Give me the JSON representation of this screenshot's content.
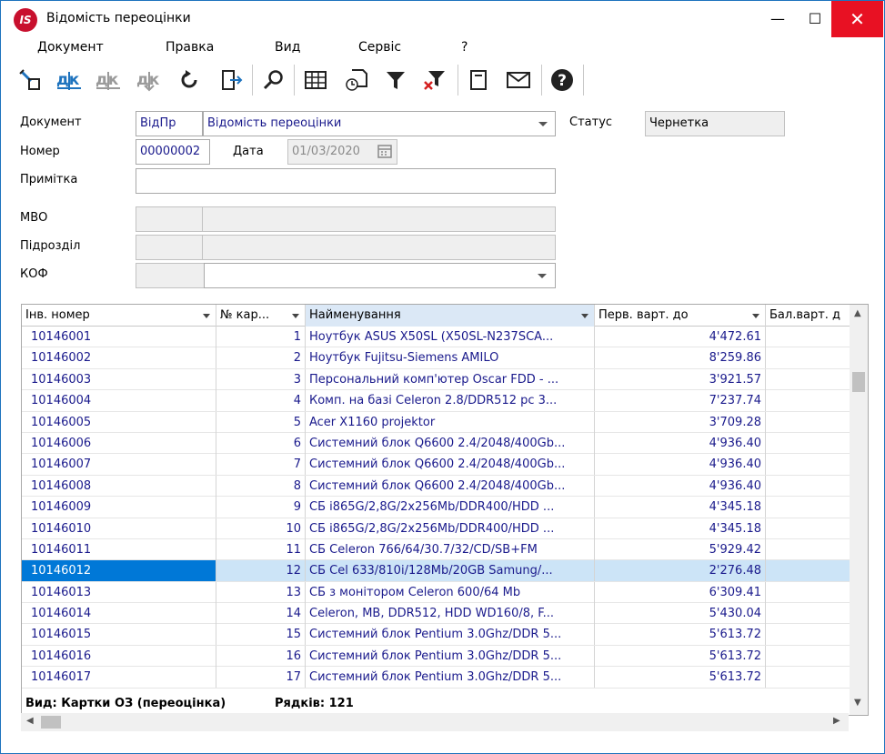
{
  "window": {
    "title": "Відомість переоцінки",
    "logo_text": "IS",
    "minimize_glyph": "—",
    "maximize_glyph": "☐",
    "close_glyph": "✕"
  },
  "menu": [
    "Документ",
    "Правка",
    "Вид",
    "Сервіс",
    "?"
  ],
  "toolbar": {
    "icons": [
      "new-document-icon",
      "dk-icon",
      "dk-disabled-icon",
      "dk-down-disabled-icon",
      "refresh-icon",
      "exit-icon",
      "search-icon",
      "table-view-icon",
      "history-icon",
      "filter-icon",
      "clear-filter-icon",
      "page-icon",
      "mail-icon",
      "help-icon"
    ]
  },
  "form": {
    "document_label": "Документ",
    "document_code": "ВідПр",
    "document_name": "Відомість переоцінки",
    "status_label": "Статус",
    "status_value": "Чернетка",
    "number_label": "Номер",
    "number_value": "00000002",
    "date_label": "Дата",
    "date_value": "01/03/2020",
    "note_label": "Примітка",
    "note_value": "",
    "mvo_label": "МВО",
    "mvo_code": "",
    "mvo_name": "",
    "dept_label": "Підрозділ",
    "dept_code": "",
    "dept_name": "",
    "kof_label": "КОФ",
    "kof_code": "",
    "kof_name": ""
  },
  "grid": {
    "columns": [
      "Інв. номер",
      "№ кар...",
      "Найменування",
      "Перв. варт. до",
      "Бал.варт. д"
    ],
    "selected_row_index": 11,
    "rows": [
      {
        "inv": "10146001",
        "card": "1",
        "name": "Ноутбук ASUS X50SL (X50SL-N237SCA...",
        "value": "4'472.61"
      },
      {
        "inv": "10146002",
        "card": "2",
        "name": "Ноутбук Fujitsu-Siemens AMILO",
        "value": "8'259.86"
      },
      {
        "inv": "10146003",
        "card": "3",
        "name": "Персональний комп'ютер Oscar FDD - ...",
        "value": "3'921.57"
      },
      {
        "inv": "10146004",
        "card": "4",
        "name": "Комп. на базі Celeron 2.8/DDR512 pc 3...",
        "value": "7'237.74"
      },
      {
        "inv": "10146005",
        "card": "5",
        "name": "Acer X1160 projektor",
        "value": "3'709.28"
      },
      {
        "inv": "10146006",
        "card": "6",
        "name": "Системний блок Q6600 2.4/2048/400Gb...",
        "value": "4'936.40"
      },
      {
        "inv": "10146007",
        "card": "7",
        "name": "Системний блок Q6600 2.4/2048/400Gb...",
        "value": "4'936.40"
      },
      {
        "inv": "10146008",
        "card": "8",
        "name": "Системний блок Q6600 2.4/2048/400Gb...",
        "value": "4'936.40"
      },
      {
        "inv": "10146009",
        "card": "9",
        "name": "СБ i865G/2,8G/2x256Mb/DDR400/HDD ...",
        "value": "4'345.18"
      },
      {
        "inv": "10146010",
        "card": "10",
        "name": "СБ i865G/2,8G/2x256Mb/DDR400/HDD ...",
        "value": "4'345.18"
      },
      {
        "inv": "10146011",
        "card": "11",
        "name": "СБ Celeron 766/64/30.7/32/CD/SB+FM",
        "value": "5'929.42"
      },
      {
        "inv": "10146012",
        "card": "12",
        "name": "СБ Cel 633/810i/128Mb/20GB Samung/...",
        "value": "2'276.48"
      },
      {
        "inv": "10146013",
        "card": "13",
        "name": "СБ з монітором Celeron 600/64 Mb",
        "value": "6'309.41"
      },
      {
        "inv": "10146014",
        "card": "14",
        "name": "Celeron, MB, DDR512, HDD WD160/8, F...",
        "value": "5'430.04"
      },
      {
        "inv": "10146015",
        "card": "15",
        "name": "Системний блок Pentium 3.0Ghz/DDR 5...",
        "value": "5'613.72"
      },
      {
        "inv": "10146016",
        "card": "16",
        "name": "Системний блок Pentium 3.0Ghz/DDR 5...",
        "value": "5'613.72"
      },
      {
        "inv": "10146017",
        "card": "17",
        "name": "Системний блок Pentium 3.0Ghz/DDR 5...",
        "value": "5'613.72"
      }
    ],
    "footer_view": "Вид: Картки ОЗ (переоцінка)",
    "footer_rows": "Рядків: 121"
  }
}
